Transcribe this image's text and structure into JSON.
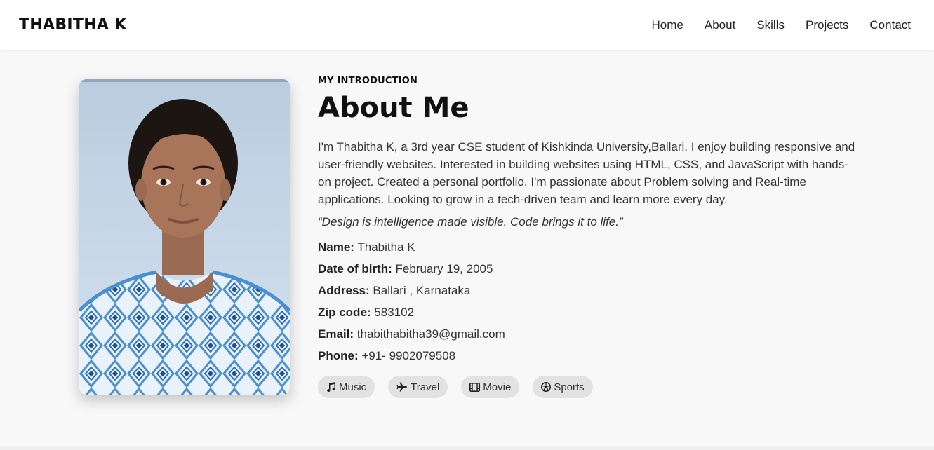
{
  "nav": {
    "brand": "THABITHA K",
    "links": [
      "Home",
      "About",
      "Skills",
      "Projects",
      "Contact"
    ]
  },
  "about": {
    "eyebrow": "MY INTRODUCTION",
    "title": "About Me",
    "bio": "I'm Thabitha K, a 3rd year CSE student of Kishkinda University,Ballari. I enjoy building responsive and user-friendly websites. Interested in building websites using HTML, CSS, and JavaScript with hands-on project. Created a personal portfolio. I'm passionate about Problem solving and Real-time applications. Looking to grow in a tech-driven team and learn more every day.",
    "quote": "“Design is intelligence made visible. Code brings it to life.”",
    "details": [
      {
        "label": "Name:",
        "value": "Thabitha K"
      },
      {
        "label": "Date of birth:",
        "value": "February 19, 2005"
      },
      {
        "label": "Address:",
        "value": "Ballari , Karnataka"
      },
      {
        "label": "Zip code:",
        "value": "583102"
      },
      {
        "label": "Email:",
        "value": "thabithabitha39@gmail.com"
      },
      {
        "label": "Phone:",
        "value": "+91- 9902079508"
      }
    ],
    "hobbies": [
      {
        "label": "Music",
        "icon": "music-icon"
      },
      {
        "label": "Travel",
        "icon": "plane-icon"
      },
      {
        "label": "Movie",
        "icon": "film-icon"
      },
      {
        "label": "Sports",
        "icon": "soccer-ball-icon"
      }
    ]
  },
  "colors": {
    "background": "#f8f8f8",
    "navbar": "#ffffff",
    "text": "#333333",
    "heading": "#111111",
    "chip": "#e2e2e2"
  }
}
